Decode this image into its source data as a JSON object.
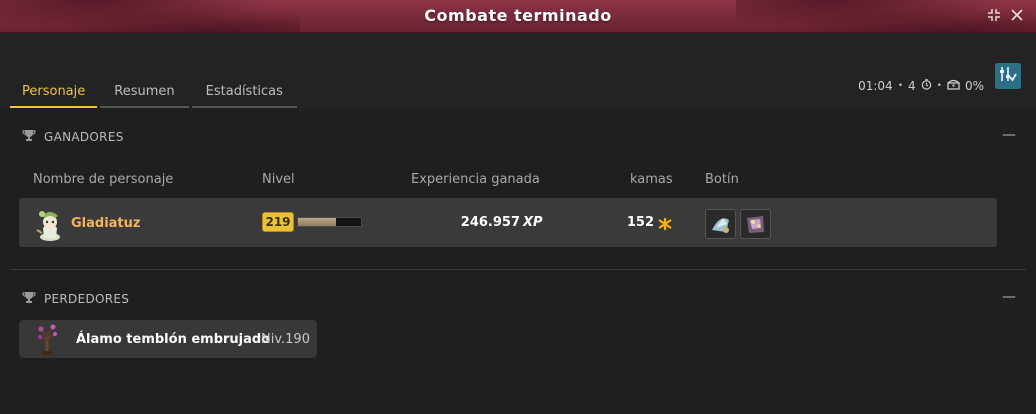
{
  "window": {
    "title": "Combate terminado",
    "accent_color": "#8e3447"
  },
  "tabs": [
    {
      "label": "Personaje",
      "active": true
    },
    {
      "label": "Resumen",
      "active": false
    },
    {
      "label": "Estadísticas",
      "active": false
    }
  ],
  "status": {
    "time": "01:04",
    "turns": "4",
    "loot_bonus": "0%"
  },
  "winners": {
    "header": "GANADORES",
    "columns": [
      "Nombre de personaje",
      "Nivel",
      "Experiencia ganada",
      "kamas",
      "Botín"
    ],
    "rows": [
      {
        "name": "Gladiatuz",
        "level": "219",
        "xp_progress": 0.6,
        "xp": "246.957",
        "xp_unit": "XP",
        "kamas": "152"
      }
    ]
  },
  "losers": {
    "header": "PERDEDORES",
    "rows": [
      {
        "name": "Álamo temblón embrujado",
        "level": "Niv.190"
      }
    ]
  }
}
